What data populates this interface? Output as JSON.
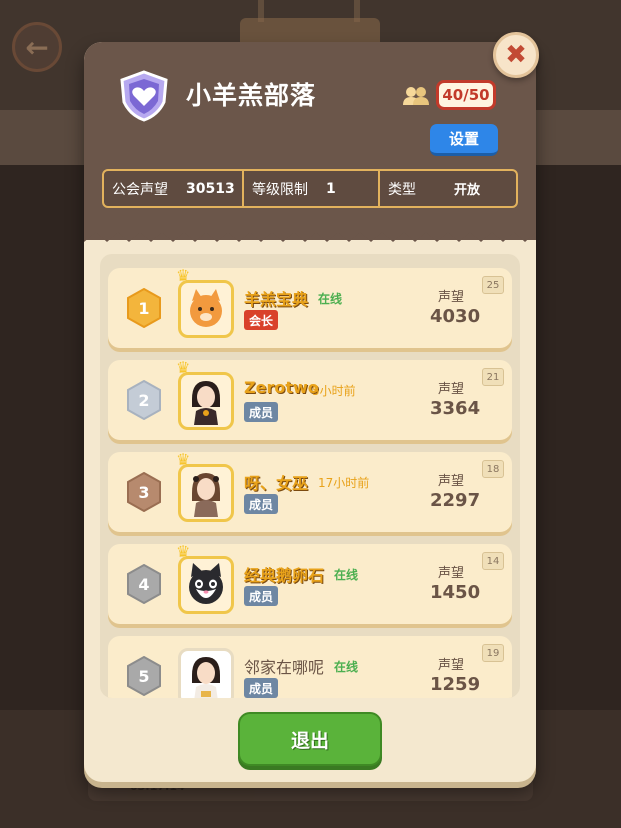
{
  "header": {
    "guild_name": "小羊羔部落",
    "member_count": "40/50",
    "settings_label": "设置",
    "stats": {
      "prestige_label": "公会声望",
      "prestige_value": "30513",
      "level_limit_label": "等级限制",
      "level_limit_value": "1",
      "type_label": "类型",
      "type_value": "开放"
    }
  },
  "members": [
    {
      "rank": "1",
      "name": "羊羔宝典",
      "status": "在线",
      "status_color": "#4caf50",
      "role": "会长",
      "role_kind": "leader",
      "prestige_label": "声望",
      "prestige": "4030",
      "level": "25",
      "avatar": "orange-cat"
    },
    {
      "rank": "2",
      "name": "Zerotwo",
      "status": "5小时前",
      "status_color": "#e8a21a",
      "role": "成员",
      "role_kind": "member",
      "prestige_label": "声望",
      "prestige": "3364",
      "level": "21",
      "avatar": "girl-dark-hair"
    },
    {
      "rank": "3",
      "name": "呀、女巫",
      "status": "17小时前",
      "status_color": "#e8a21a",
      "role": "成员",
      "role_kind": "member",
      "prestige_label": "声望",
      "prestige": "2297",
      "level": "18",
      "avatar": "girl-brown-hair"
    },
    {
      "rank": "4",
      "name": "经典鹅卵石",
      "status": "在线",
      "status_color": "#4caf50",
      "role": "成员",
      "role_kind": "member",
      "prestige_label": "声望",
      "prestige": "1450",
      "level": "14",
      "avatar": "tuxedo-cat"
    },
    {
      "rank": "5",
      "name": "邻家在哪呢",
      "status": "在线",
      "status_color": "#4caf50",
      "role": "成员",
      "role_kind": "member",
      "prestige_label": "声望",
      "prestige": "1259",
      "level": "19",
      "avatar": "girl-white-top"
    }
  ],
  "footer": {
    "exit_label": "退出"
  },
  "background": {
    "bottom_stamp": "03:17:14"
  },
  "colors": {
    "header_bg": "#6b564a",
    "panel_bg": "#f4e8cf",
    "accent_gold": "#e2b25d",
    "settings_blue": "#2e86e8",
    "exit_green": "#5ab33a",
    "leader_red": "#d9412a"
  }
}
